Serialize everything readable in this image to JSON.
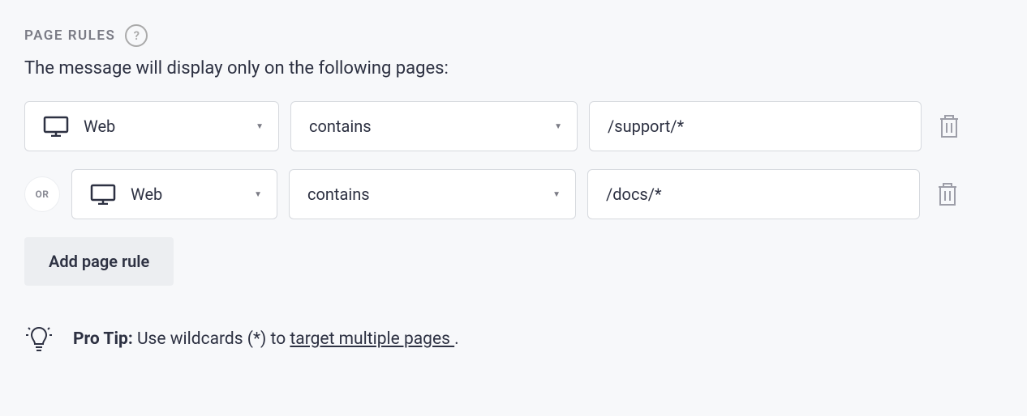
{
  "section": {
    "title": "PAGE RULES",
    "subtitle": "The message will display only on the following pages:"
  },
  "rules": [
    {
      "platform": "Web",
      "condition": "contains",
      "value": "/support/*"
    },
    {
      "platform": "Web",
      "condition": "contains",
      "value": "/docs/*"
    }
  ],
  "connector_label": "OR",
  "add_button_label": "Add page rule",
  "pro_tip": {
    "label": "Pro Tip:",
    "text_before": " Use wildcards (*) to ",
    "link_text": "target multiple pages ",
    "text_after": "."
  }
}
